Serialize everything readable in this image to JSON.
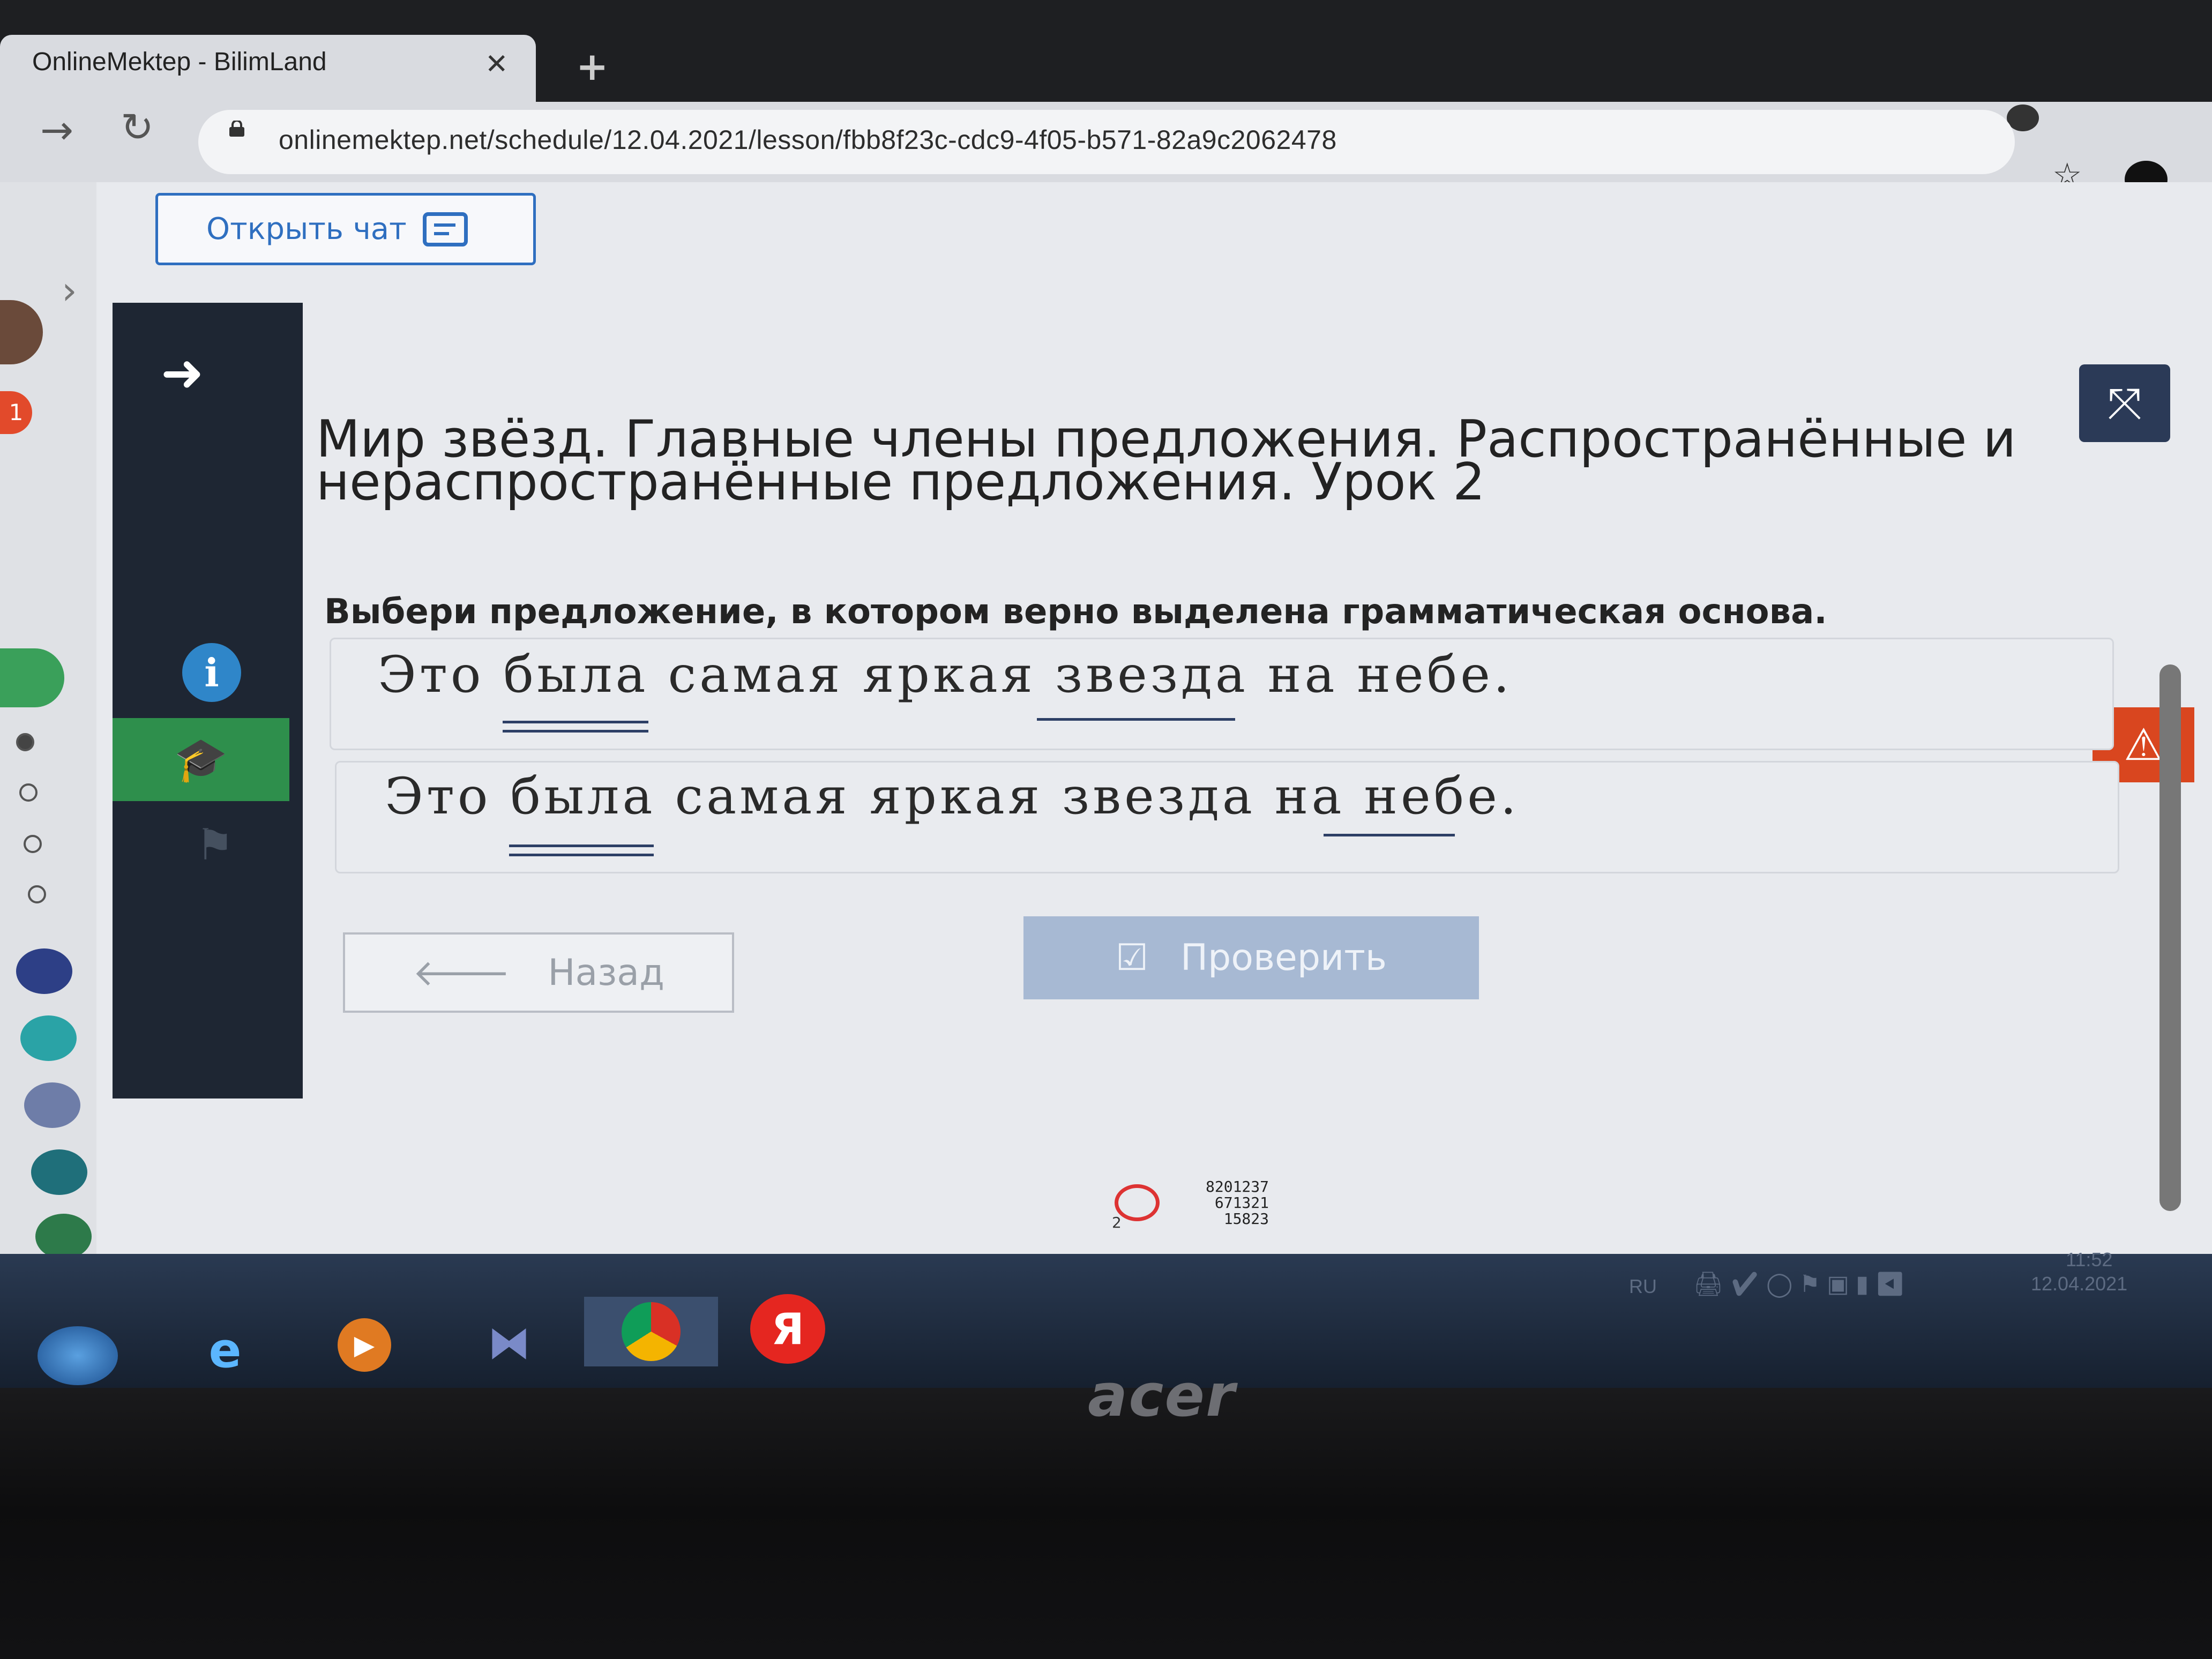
{
  "browser": {
    "tab_title": "OnlineMektep - BilimLand",
    "tab_close": "✕",
    "new_tab": "+",
    "url": "onlinemektep.net/schedule/12.04.2021/lesson/fbb8f23c-cdc9-4f05-b571-82a9c2062478"
  },
  "rail": {
    "badge": "1"
  },
  "page": {
    "chat_button": "Открыть чат",
    "lesson_title": "Мир звёзд. Главные члены предложения. Распространённые и нераспространённые предложения. Урок 2",
    "question": "Выбери предложение, в котором верно выделена грамматическая основа.",
    "options": [
      {
        "text": "Это была самая яркая звезда на небе.",
        "double_underlined": "была",
        "single_underlined": "звезда"
      },
      {
        "text": "Это была самая яркая звезда на небе.",
        "double_underlined": "была",
        "single_underlined": "небе"
      }
    ],
    "back_button": "Назад",
    "check_button": "Проверить"
  },
  "overlay": {
    "counter_small": "2",
    "numbers": [
      "8201237",
      "671321",
      "15823"
    ]
  },
  "taskbar": {
    "language": "RU",
    "yandex_letter": "Я",
    "time": "11:52",
    "date": "12.04.2021"
  },
  "device": {
    "brand": "acer"
  },
  "colors": {
    "accent_blue": "#2f6fc0",
    "sidebar_dark": "#1e2633",
    "sidebar_active": "#2e8f4c",
    "warning": "#d9461f",
    "check_button": "#a7b9d3"
  },
  "icons": {
    "chat": "speech-bubble-icon",
    "expand": "fullscreen-icon",
    "warning": "warning-triangle-icon",
    "info": "info-icon",
    "graduation": "graduation-cap-icon",
    "flag": "flag-icon",
    "back_arrow": "arrow-left-icon",
    "check": "checkbox-icon"
  }
}
